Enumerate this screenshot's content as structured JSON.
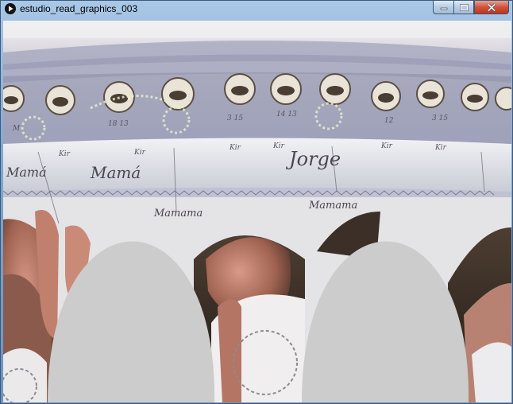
{
  "window": {
    "title": "estudio_read_graphics_003",
    "controls": {
      "minimize_icon": "minimize-icon",
      "maximize_icon": "maximize-icon",
      "close_icon": "close-icon"
    }
  },
  "canvas": {
    "background_color": "#cfcfcf",
    "wall_color": "#e9e7ea",
    "stripe_color": "#a9abc2",
    "skin_color": "#b07768",
    "dark_color": "#3e2f27",
    "arch_color": "#cccccc",
    "glow_color": "#ccd8c0",
    "texts": {
      "word_1": "Mamá",
      "word_2": "Jorge",
      "word_3": "Mamama",
      "word_4": "Mamama",
      "word_5": "Mamá"
    }
  }
}
